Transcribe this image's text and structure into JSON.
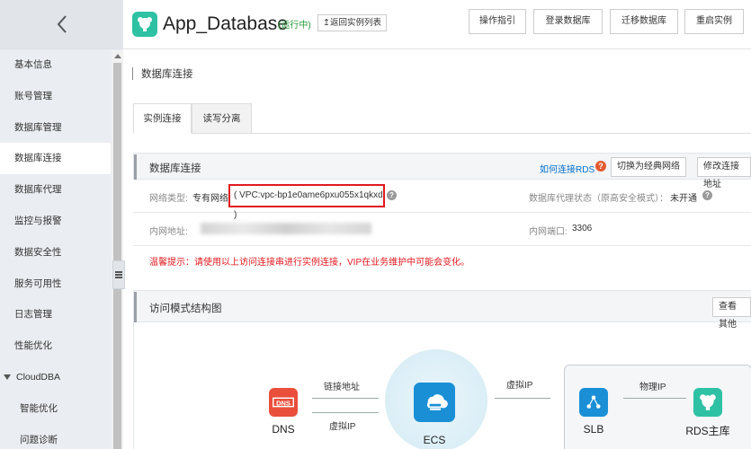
{
  "sidebar": {
    "items": [
      {
        "label": "基本信息"
      },
      {
        "label": "账号管理"
      },
      {
        "label": "数据库管理"
      },
      {
        "label": "数据库连接"
      },
      {
        "label": "数据库代理"
      },
      {
        "label": "监控与报警"
      },
      {
        "label": "数据安全性"
      },
      {
        "label": "服务可用性"
      },
      {
        "label": "日志管理"
      },
      {
        "label": "性能优化"
      },
      {
        "label": "CloudDBA"
      },
      {
        "label": "智能优化"
      },
      {
        "label": "问题诊断"
      }
    ],
    "active_index": 3
  },
  "header": {
    "title": "App_Database",
    "status": "(运行中)",
    "back_label": "↥返回实例列表",
    "buttons": [
      "操作指引",
      "登录数据库",
      "迁移数据库",
      "重启实例"
    ]
  },
  "main": {
    "section_title": "数据库连接",
    "tabs": [
      {
        "label": "实例连接"
      },
      {
        "label": "读写分离"
      }
    ],
    "panel": {
      "title": "数据库连接",
      "how_link": "如何连接RDS",
      "switch_btn": "切换为经典网络",
      "modify_btn": "修改连接地址",
      "network_type_label": "网络类型:",
      "network_type_value": "专有网络",
      "vpc_value": "( VPC:vpc-bp1e0ame6pxu055x1qkxd )",
      "proxy_label": "数据库代理状态（原高安全模式）：",
      "proxy_value": "未开通",
      "intranet_addr_label": "内网地址:",
      "intranet_port_label": "内网端口:",
      "intranet_port_value": "3306",
      "tip": "温馨提示：请使用以上访问连接串进行实例连接，VIP在业务维护中可能会变化。"
    },
    "panel2": {
      "title": "访问模式结构图",
      "view_btn": "查看其他"
    },
    "diagram": {
      "dns": "DNS",
      "ecs": "ECS",
      "slb": "SLB",
      "rds": "RDS主库",
      "link_addr": "链接地址",
      "vip1": "虚拟IP",
      "vip2": "虚拟IP",
      "physical_ip": "物理IP"
    }
  },
  "colors": {
    "accent": "#2ec1a4",
    "link": "#0070cc",
    "alert": "#e0191f"
  }
}
